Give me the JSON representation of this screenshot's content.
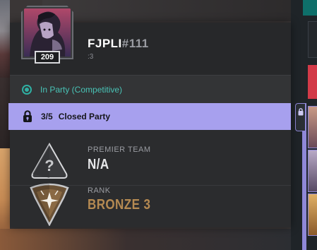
{
  "player": {
    "name": "FJPLI",
    "tag": "#111",
    "subtitle": ":3",
    "level": "209"
  },
  "status": {
    "text": "In Party (Competitive)",
    "color": "#2fb0a3"
  },
  "party": {
    "count": "3/5",
    "label": "Closed Party",
    "color": "#a7a0ee"
  },
  "premier": {
    "label": "PREMIER TEAM",
    "value": "N/A"
  },
  "rank": {
    "label": "RANK",
    "value": "BRONZE 3",
    "color": "#b58a52"
  },
  "icons": {
    "party_lock": "lock-icon",
    "premier_emblem": "question-triangle-icon",
    "rank_emblem": "bronze-rank-icon",
    "side_lock": "lock-icon"
  }
}
